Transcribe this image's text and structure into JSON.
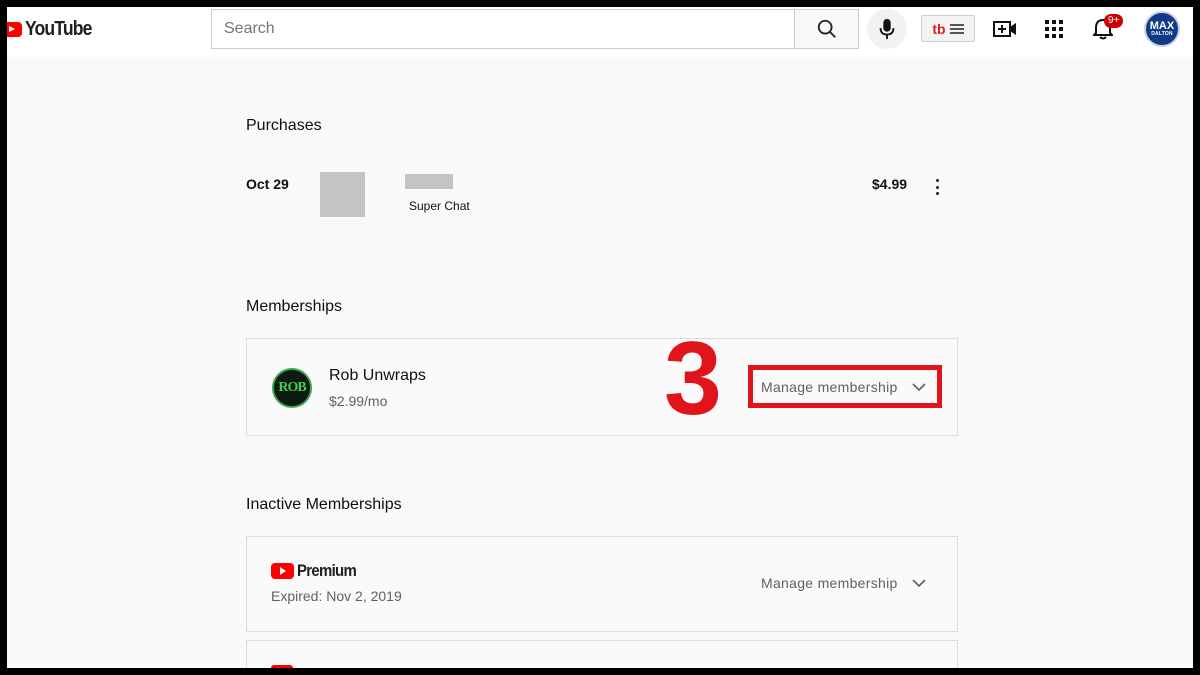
{
  "header": {
    "logo_text": "YouTube",
    "search_placeholder": "Search",
    "tubebuddy_label": "tb",
    "notification_count": "9+",
    "avatar_line1": "MAX",
    "avatar_line2": "DALTON"
  },
  "purchases": {
    "title": "Purchases",
    "items": [
      {
        "date": "Oct 29",
        "type": "Super Chat",
        "price": "$4.99"
      }
    ]
  },
  "memberships": {
    "title": "Memberships",
    "items": [
      {
        "channel": "Rob Unwraps",
        "avatar_text": "ROB",
        "price": "$2.99/mo",
        "action": "Manage membership"
      }
    ]
  },
  "inactive_memberships": {
    "title": "Inactive Memberships",
    "items": [
      {
        "brand": "Premium",
        "status": "Expired: Nov 2, 2019",
        "action": "Manage membership"
      }
    ]
  },
  "annotation": {
    "step_number": "3",
    "color": "#e1141b"
  },
  "colors": {
    "brand_red": "#ff0000",
    "page_bg": "#f9f9f9",
    "avatar_bg": "#123a86"
  }
}
